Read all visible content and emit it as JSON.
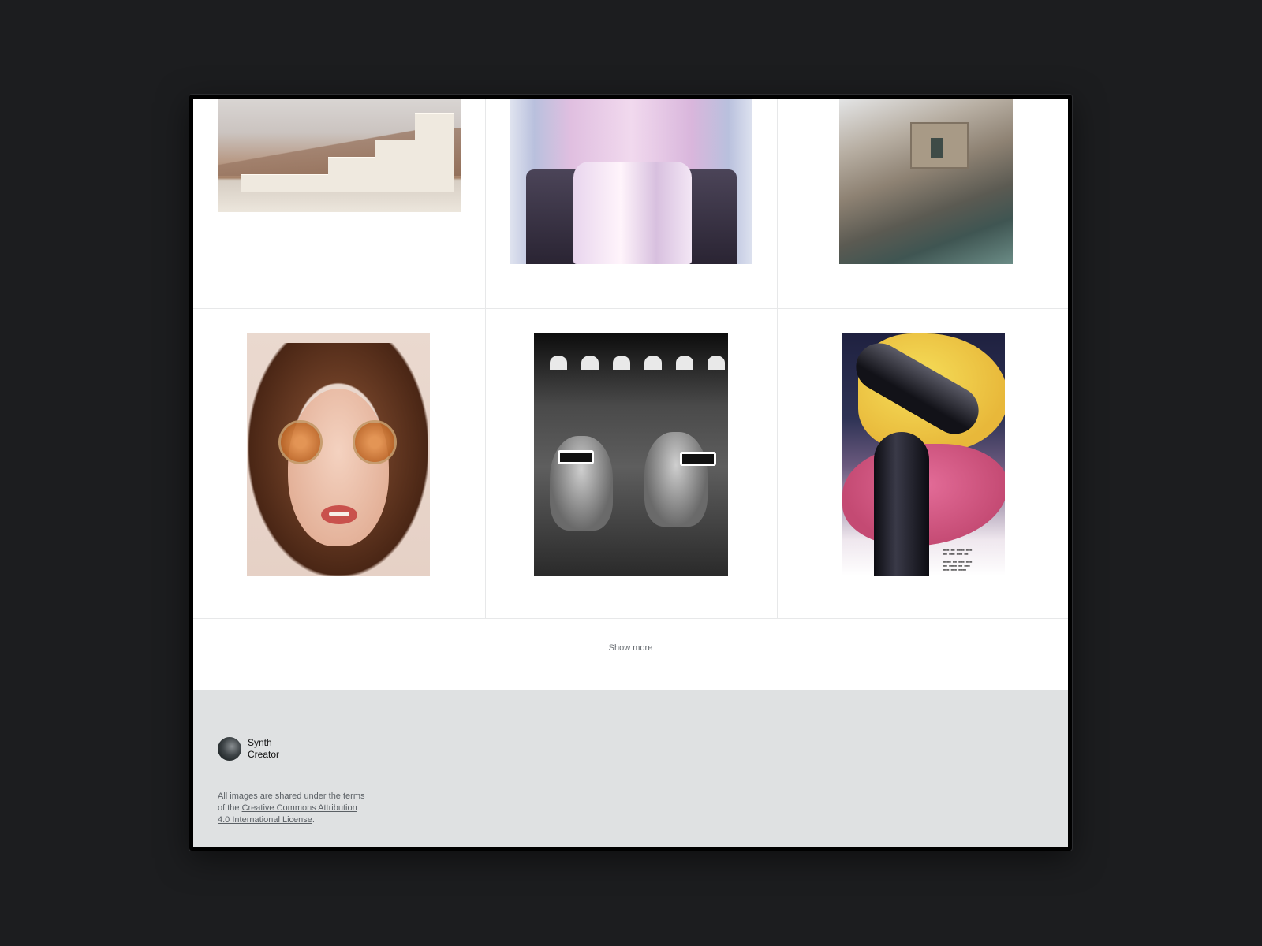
{
  "gallery": {
    "rows": [
      [
        {
          "alt": "stairs-in-desert-photo"
        },
        {
          "alt": "person-in-pink-suit-photo"
        },
        {
          "alt": "stone-house-on-cliff-photo"
        }
      ],
      [
        {
          "alt": "woman-with-tinted-glasses-photo"
        },
        {
          "alt": "cinema-audience-3d-glasses-photo"
        },
        {
          "alt": "abstract-hand-poster"
        }
      ]
    ],
    "show_more_label": "Show more"
  },
  "footer": {
    "author_name_line1": "Synth",
    "author_name_line2": "Creator",
    "license_prefix": "All images are shared under the terms of the ",
    "license_link": "Creative Commons Attribution 4.0 International License",
    "license_suffix": "."
  },
  "colors": {
    "page_background": "#1c1d1f",
    "footer_background": "#dfe1e2",
    "divider": "#e7e8e9"
  }
}
